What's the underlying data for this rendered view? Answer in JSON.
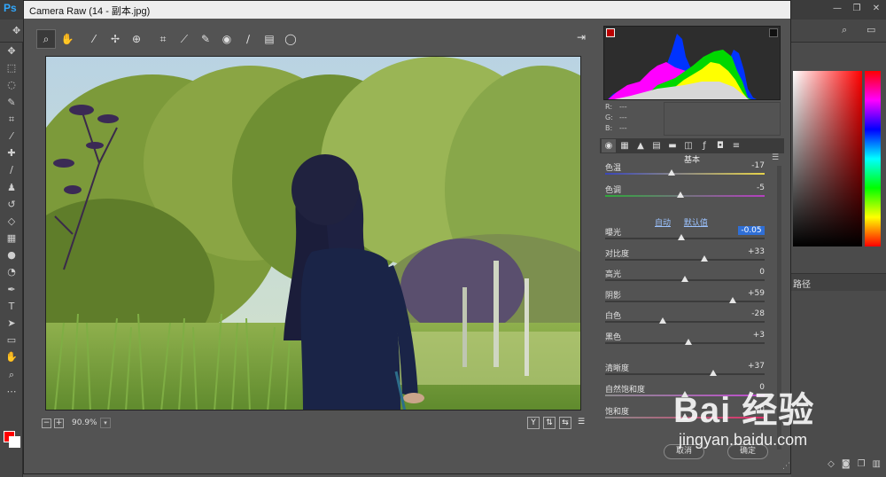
{
  "ps": {
    "logo": "Ps",
    "window_controls": [
      "—",
      "❐",
      "✕"
    ],
    "panel_tab": "路径"
  },
  "dialog": {
    "title": "Camera Raw (14 - 副本.jpg)",
    "close": "✕"
  },
  "histogram": {
    "r_label": "R:",
    "r_value": "---",
    "g_label": "G:",
    "g_value": "---",
    "b_label": "B:",
    "b_value": "---"
  },
  "panel": {
    "section_title": "基本",
    "auto_label": "自动",
    "default_label": "默认值"
  },
  "adjustments": [
    {
      "id": "temperature",
      "label": "色温",
      "value": "-17",
      "level": 0.415,
      "track": "linear-gradient(to right,#3a46b8,#e6d34a)"
    },
    {
      "id": "tint",
      "label": "色调",
      "value": "-5",
      "level": 0.47,
      "track": "linear-gradient(to right,#2fa83a,#b53fc0)"
    },
    {
      "id": "exposure",
      "label": "曝光",
      "value": "-0.05",
      "level": 0.48,
      "track": "",
      "selected": true
    },
    {
      "id": "contrast",
      "label": "对比度",
      "value": "+33",
      "level": 0.62,
      "track": ""
    },
    {
      "id": "highlights",
      "label": "高光",
      "value": "0",
      "level": 0.5,
      "track": ""
    },
    {
      "id": "shadows",
      "label": "阴影",
      "value": "+59",
      "level": 0.8,
      "track": ""
    },
    {
      "id": "whites",
      "label": "白色",
      "value": "-28",
      "level": 0.36,
      "track": ""
    },
    {
      "id": "blacks",
      "label": "黑色",
      "value": "+3",
      "level": 0.52,
      "track": ""
    },
    {
      "id": "clarity",
      "label": "清晰度",
      "value": "+37",
      "level": 0.68,
      "track": ""
    },
    {
      "id": "vibrance",
      "label": "自然饱和度",
      "value": "0",
      "level": 0.5,
      "track": "linear-gradient(to right,#8a8a8a,#c04dd0)"
    },
    {
      "id": "saturation",
      "label": "饱和度",
      "value": "0",
      "level": 0.5,
      "track": "linear-gradient(to right,#8a8a8a,#e0306a)"
    }
  ],
  "status": {
    "zoom_out": "−",
    "zoom_in": "+",
    "zoom": "90.9%",
    "zoom_dd": "▾",
    "view_y": "Y"
  },
  "buttons": {
    "cancel": "取消",
    "ok": "确定"
  },
  "watermark": {
    "logo": "Bai 经验",
    "url": "jingyan.baidu.com"
  },
  "colors": {
    "accent": "#2f6fd6",
    "foreground": "#ff0000"
  }
}
